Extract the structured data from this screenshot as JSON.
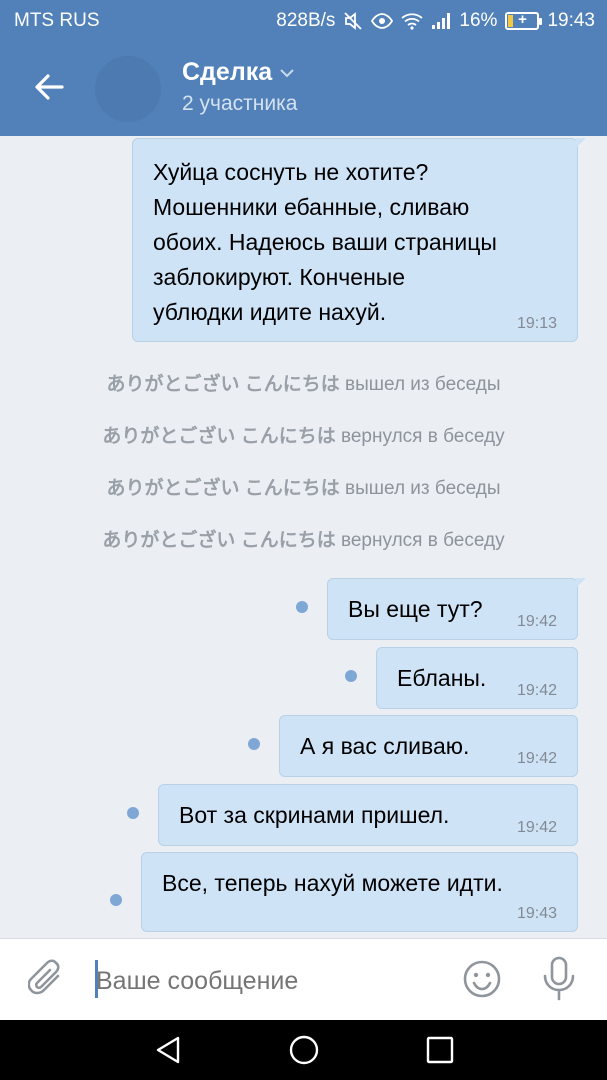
{
  "status_bar": {
    "carrier": "MTS RUS",
    "speed": "828B/s",
    "battery": "16%",
    "battery_level": 0.16,
    "time": "19:43",
    "icons": [
      "mute-icon",
      "eye-icon",
      "wifi-icon",
      "signal-icon",
      "battery-charging-icon"
    ]
  },
  "header": {
    "title": "Сделка",
    "subtitle": "2 участника"
  },
  "messages": [
    {
      "text": "Хуйца соснуть не хотите?\nМошенники ебанные, сливаю\nобоих. Надеюсь ваши страницы\nзаблокируют. Конченые\nублюдки идите нахуй.",
      "time": "19:13",
      "unread": false
    },
    {
      "text": "Вы еще тут?",
      "time": "19:42",
      "unread": true
    },
    {
      "text": "Ебланы.",
      "time": "19:42",
      "unread": true
    },
    {
      "text": "А я вас сливаю.",
      "time": "19:42",
      "unread": true
    },
    {
      "text": "Вот за скринами пришел.",
      "time": "19:42",
      "unread": true
    },
    {
      "text": "Все, теперь нахуй можете идти.",
      "time": "19:43",
      "unread": true
    }
  ],
  "service_messages": [
    {
      "who": "ありがとござい こんにちは",
      "action": "вышел из беседы"
    },
    {
      "who": "ありがとござい こんにちは",
      "action": "вернулся в беседу"
    },
    {
      "who": "ありがとござい こんにちは",
      "action": "вышел из беседы"
    },
    {
      "who": "ありがとござい こんにちは",
      "action": "вернулся в беседу"
    }
  ],
  "composer": {
    "placeholder": "Ваше сообщение"
  },
  "colors": {
    "header": "#5181b8",
    "bubble_out": "#cfe3f7",
    "background": "#ebeff4",
    "unread_dot": "#7fa7d6"
  }
}
